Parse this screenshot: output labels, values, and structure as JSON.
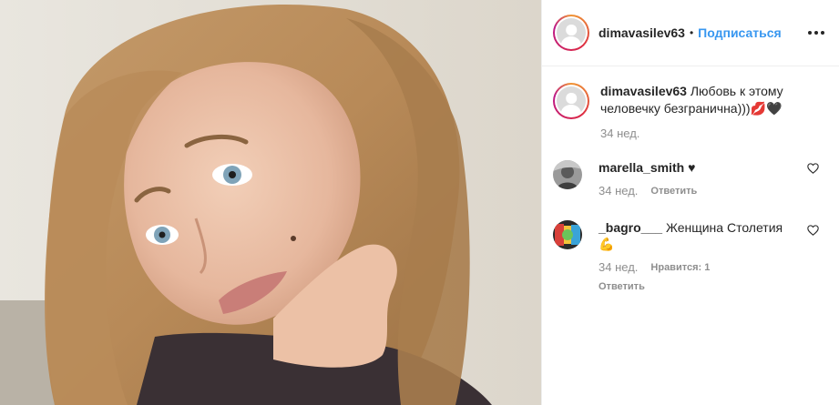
{
  "header": {
    "username": "dimavasilev63",
    "separator": "•",
    "follow_label": "Подписаться"
  },
  "caption": {
    "username": "dimavasilev63",
    "text": "Любовь к этому человечку безгранична)))💋🖤",
    "time": "34 нед."
  },
  "comments": [
    {
      "username": "marella_smith",
      "text": "♥",
      "time": "34 нед.",
      "reply_label": "Ответить",
      "likes_label": ""
    },
    {
      "username": "_bagro___",
      "text": "Женщина Столетия💪",
      "time": "34 нед.",
      "likes_label": "Нравится: 1",
      "reply_label": "Ответить"
    }
  ],
  "icons": {
    "more": "more-options-icon",
    "heart": "heart-outline-icon"
  },
  "colors": {
    "accent": "#3897f0",
    "text": "#262626",
    "secondary": "#8e8e8e",
    "border": "#efefef"
  }
}
